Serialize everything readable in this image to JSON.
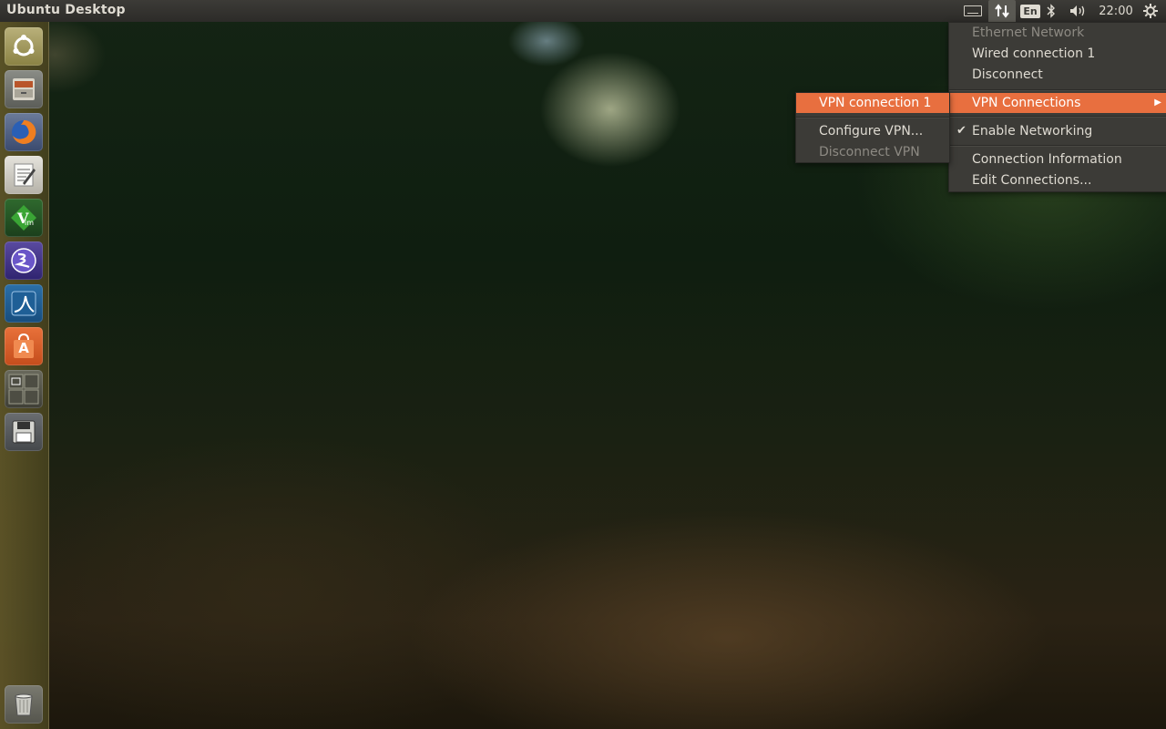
{
  "top_panel": {
    "title": "Ubuntu Desktop",
    "lang": "En",
    "clock": "22:00"
  },
  "launcher": {
    "items": [
      {
        "name": "dash"
      },
      {
        "name": "files"
      },
      {
        "name": "firefox"
      },
      {
        "name": "text-editor"
      },
      {
        "name": "vim"
      },
      {
        "name": "emacs"
      },
      {
        "name": "wireshark"
      },
      {
        "name": "software-center",
        "glyph": "A"
      },
      {
        "name": "workspaces"
      },
      {
        "name": "save"
      },
      {
        "name": "trash"
      }
    ]
  },
  "network_menu": {
    "items": [
      {
        "label": "Ethernet Network",
        "state": "disabled"
      },
      {
        "label": "Wired connection 1"
      },
      {
        "label": "Disconnect"
      },
      {
        "label": "VPN Connections",
        "state": "highlighted",
        "has_submenu": true
      },
      {
        "label": "Enable Networking",
        "checked": true
      },
      {
        "label": "Connection Information"
      },
      {
        "label": "Edit Connections..."
      }
    ]
  },
  "vpn_submenu": {
    "items": [
      {
        "label": "VPN connection 1",
        "state": "highlighted"
      },
      {
        "label": "Configure VPN..."
      },
      {
        "label": "Disconnect VPN",
        "state": "disabled"
      }
    ]
  },
  "colors": {
    "highlight": "#e86f3f",
    "panel": "#3c3b37",
    "launcher": "#5f5528"
  }
}
